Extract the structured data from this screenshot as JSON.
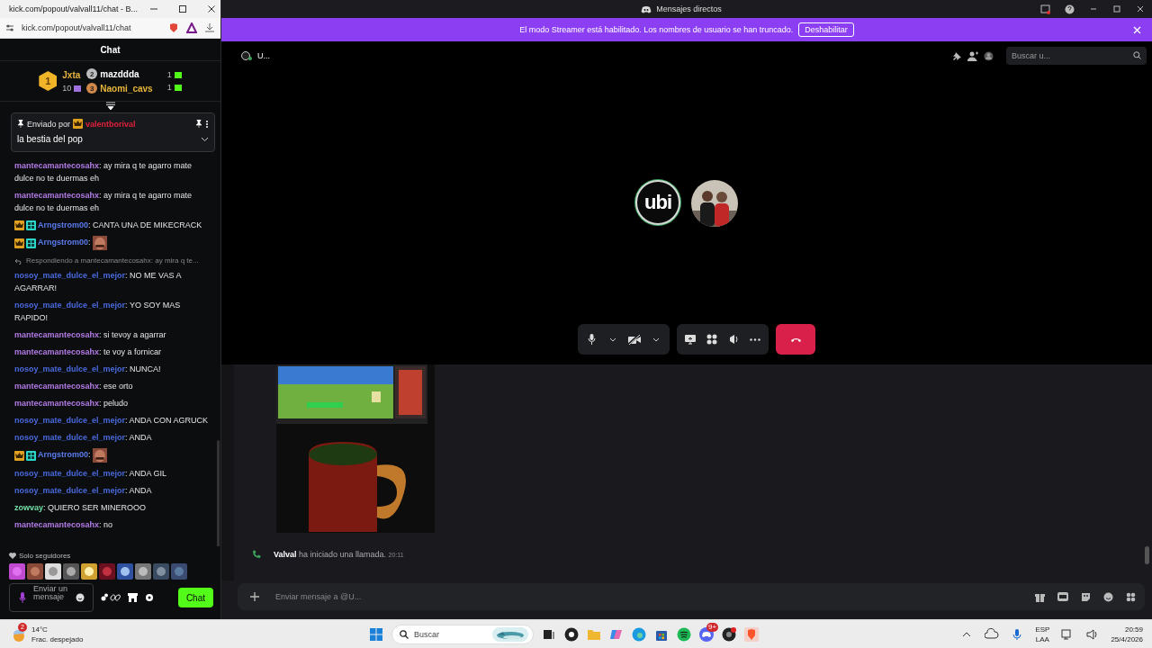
{
  "browser_window": {
    "title": "kick.com/popout/valvall11/chat - B...",
    "url": "kick.com/popout/valvall11/chat"
  },
  "kick_chat": {
    "title": "Chat",
    "leaderboard": [
      {
        "rank": "1",
        "name": "Jxta",
        "count": "10"
      },
      {
        "rank": "2",
        "name": "mazddda",
        "count": "1"
      },
      {
        "rank": "3",
        "name": "Naomi_cavs",
        "count": "1"
      }
    ],
    "pinned": {
      "label": "Enviado por",
      "user": "valentborival",
      "text": "la bestia del pop"
    },
    "messages": [
      {
        "kind": "text",
        "badges": false,
        "user": "mantecamantecosahx",
        "color": "#b37be6",
        "text": ": ay mira q te agarro mate dulce no te duermas eh"
      },
      {
        "kind": "text",
        "badges": false,
        "user": "mantecamantecosahx",
        "color": "#b37be6",
        "text": ": ay mira q te agarro mate dulce no te duermas eh"
      },
      {
        "kind": "text",
        "badges": true,
        "user": "Arngstrom00",
        "color": "#5b7cf0",
        "text": ": CANTA UNA DE MIKECRACK"
      },
      {
        "kind": "emote",
        "badges": true,
        "user": "Arngstrom00",
        "color": "#5b7cf0",
        "text": ":"
      },
      {
        "kind": "reply",
        "badges": false,
        "reply_to": "Respondiendo a mantecamantecosahx: ay mira q te...",
        "user": "nosoy_mate_dulce_el_mejor",
        "color": "#4a6ae0",
        "text": ": NO ME VAS A AGARRAR!"
      },
      {
        "kind": "text",
        "badges": false,
        "user": "nosoy_mate_dulce_el_mejor",
        "color": "#4a6ae0",
        "text": ": YO SOY MAS RAPIDO!"
      },
      {
        "kind": "text",
        "badges": false,
        "user": "mantecamantecosahx",
        "color": "#b37be6",
        "text": ": si tevoy a agarrar"
      },
      {
        "kind": "text",
        "badges": false,
        "user": "mantecamantecosahx",
        "color": "#b37be6",
        "text": ": te voy a fornicar"
      },
      {
        "kind": "text",
        "badges": false,
        "user": "nosoy_mate_dulce_el_mejor",
        "color": "#4a6ae0",
        "text": ": NUNCA!"
      },
      {
        "kind": "text",
        "badges": false,
        "user": "mantecamantecosahx",
        "color": "#b37be6",
        "text": ": ese orto"
      },
      {
        "kind": "text",
        "badges": false,
        "user": "mantecamantecosahx",
        "color": "#b37be6",
        "text": ": peludo"
      },
      {
        "kind": "text",
        "badges": false,
        "user": "nosoy_mate_dulce_el_mejor",
        "color": "#4a6ae0",
        "text": ": ANDA CON AGRUCK"
      },
      {
        "kind": "text",
        "badges": false,
        "user": "nosoy_mate_dulce_el_mejor",
        "color": "#4a6ae0",
        "text": ": ANDA"
      },
      {
        "kind": "emote",
        "badges": true,
        "user": "Arngstrom00",
        "color": "#5b7cf0",
        "text": ":"
      },
      {
        "kind": "text",
        "badges": false,
        "user": "nosoy_mate_dulce_el_mejor",
        "color": "#4a6ae0",
        "text": ": ANDA GIL"
      },
      {
        "kind": "text",
        "badges": false,
        "user": "nosoy_mate_dulce_el_mejor",
        "color": "#4a6ae0",
        "text": ": ANDA"
      },
      {
        "kind": "text",
        "badges": false,
        "user": "zowvay",
        "color": "#74e0a8",
        "text": ": QUIERO SER MINEROOO"
      },
      {
        "kind": "text",
        "badges": false,
        "user": "mantecamantecosahx",
        "color": "#b37be6",
        "text": ": no"
      }
    ],
    "mode": "Solo seguidores",
    "input": {
      "placeholder": "Enviar un mensaje"
    },
    "send_button": "Chat"
  },
  "discord": {
    "window_title": "Mensajes directos",
    "banner": {
      "text": "El modo Streamer está habilitado. Los nombres de usuario se han truncado.",
      "button": "Deshabilitar"
    },
    "channel": {
      "name": "U..."
    },
    "search": {
      "placeholder": "Buscar u..."
    },
    "call": {
      "participants": [
        {
          "kind": "logo",
          "text": "ubi"
        },
        {
          "kind": "picture"
        }
      ]
    },
    "messages": [
      {
        "kind": "picture"
      },
      {
        "kind": "call",
        "user": "Valval",
        "text": "ha iniciado una llamada.",
        "time": "20:11"
      }
    ],
    "composer": {
      "placeholder": "Enviar mensaje a @U..."
    }
  },
  "taskbar": {
    "weather": {
      "badge": "2",
      "temp": "14°C",
      "condition": "Frac. despejado"
    },
    "search": {
      "placeholder": "Buscar"
    },
    "chat_app_badge": "9+",
    "language": {
      "code": "ESP",
      "layout": "LAA"
    },
    "clock": {
      "time": "20:59",
      "date": "25/4/2026"
    }
  }
}
